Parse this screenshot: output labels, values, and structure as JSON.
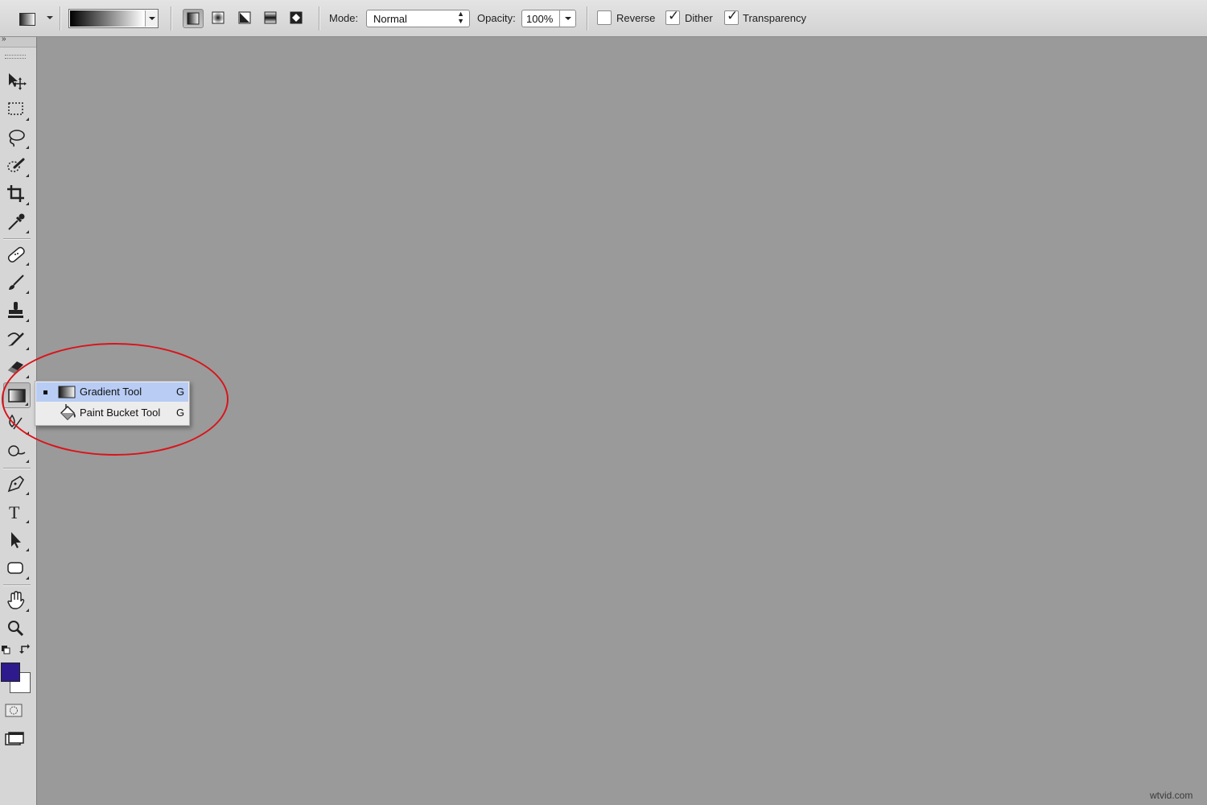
{
  "options_bar": {
    "mode_label": "Mode:",
    "mode_value": "Normal",
    "opacity_label": "Opacity:",
    "opacity_value": "100%",
    "reverse_label": "Reverse",
    "reverse_checked": false,
    "dither_label": "Dither",
    "dither_checked": true,
    "transparency_label": "Transparency",
    "transparency_checked": true,
    "collapse_glyph": "»",
    "gradient_styles": [
      "linear-gradient",
      "radial-gradient",
      "angle-gradient",
      "reflected-gradient",
      "diamond-gradient"
    ],
    "active_gradient_style": "linear-gradient"
  },
  "toolbar": {
    "tools": [
      "move",
      "rectangular-marquee",
      "lasso",
      "quick-selection",
      "crop",
      "eyedropper",
      "spot-healing-brush",
      "brush",
      "clone-stamp",
      "history-brush",
      "eraser",
      "gradient",
      "blur",
      "dodge",
      "pen",
      "type",
      "path-selection",
      "rectangle",
      "hand",
      "zoom"
    ],
    "active_tool": "gradient",
    "foreground_color": "#2e1a8c",
    "background_color": "#ffffff"
  },
  "flyout": {
    "items": [
      {
        "label": "Gradient Tool",
        "shortcut": "G",
        "selected": true,
        "icon": "gradient-icon"
      },
      {
        "label": "Paint Bucket Tool",
        "shortcut": "G",
        "selected": false,
        "icon": "paint-bucket-icon"
      }
    ]
  },
  "annotation": {
    "highlight_color": "#d9141b"
  },
  "canvas": {
    "background": "#9a9a9a"
  },
  "watermark": "wtvid.com"
}
